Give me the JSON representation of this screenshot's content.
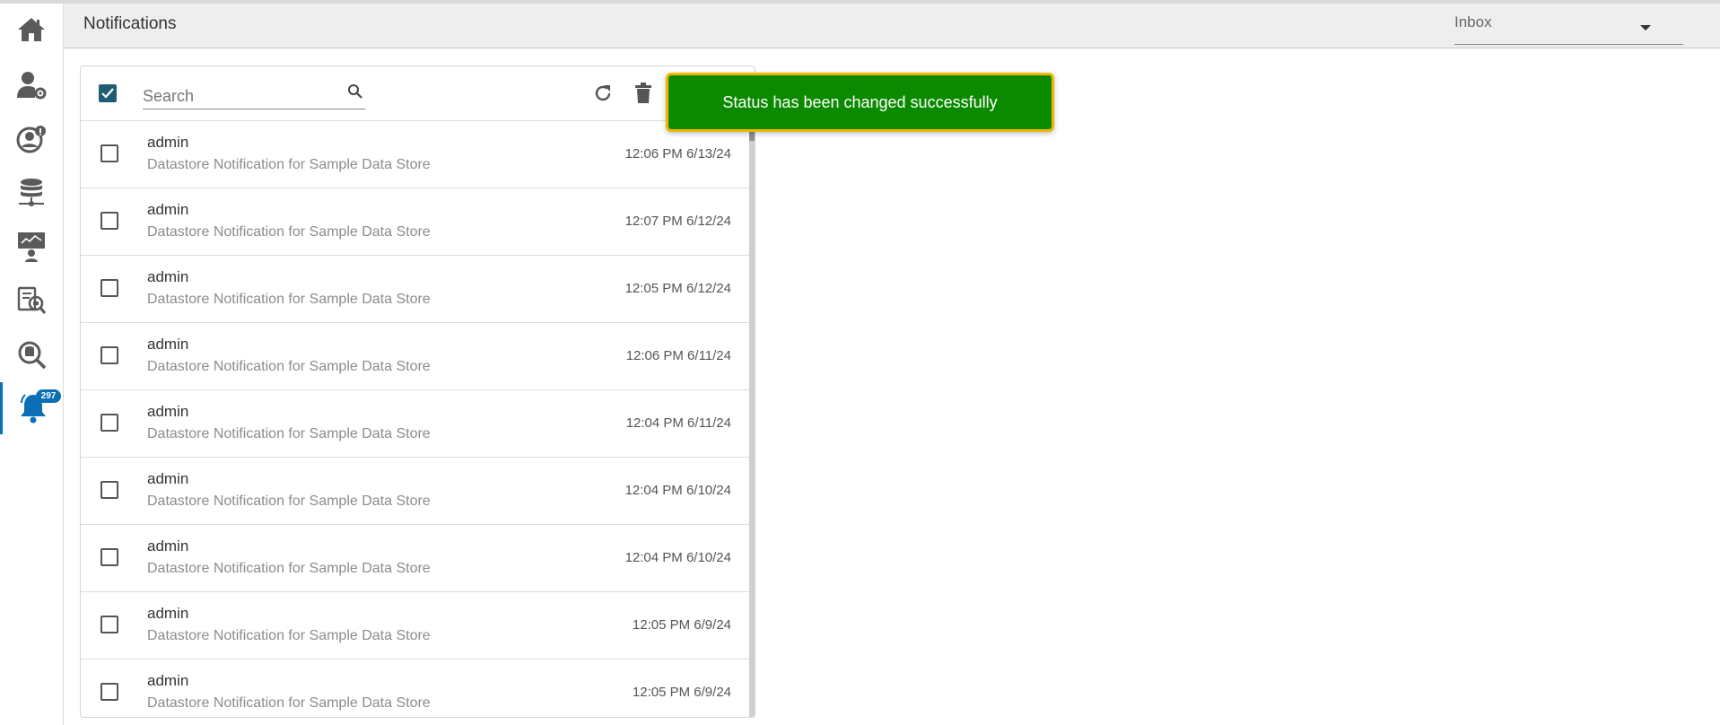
{
  "header": {
    "title": "Notifications"
  },
  "folder": {
    "selected": "Inbox"
  },
  "sidebar": {
    "items": [
      {
        "icon": "home-icon"
      },
      {
        "icon": "user-settings-icon"
      },
      {
        "icon": "user-security-icon"
      },
      {
        "icon": "database-network-icon"
      },
      {
        "icon": "dashboard-presenter-icon"
      },
      {
        "icon": "report-search-icon"
      },
      {
        "icon": "data-search-icon"
      },
      {
        "icon": "bell-icon",
        "badge": "297",
        "active": true
      }
    ]
  },
  "search": {
    "placeholder": "Search",
    "value": ""
  },
  "toast": {
    "message": "Status has been changed successfully"
  },
  "notifications": [
    {
      "sender": "admin",
      "subject": "Datastore Notification for Sample Data Store",
      "time": "12:06 PM 6/13/24"
    },
    {
      "sender": "admin",
      "subject": "Datastore Notification for Sample Data Store",
      "time": "12:07 PM 6/12/24"
    },
    {
      "sender": "admin",
      "subject": "Datastore Notification for Sample Data Store",
      "time": "12:05 PM 6/12/24"
    },
    {
      "sender": "admin",
      "subject": "Datastore Notification for Sample Data Store",
      "time": "12:06 PM 6/11/24"
    },
    {
      "sender": "admin",
      "subject": "Datastore Notification for Sample Data Store",
      "time": "12:04 PM 6/11/24"
    },
    {
      "sender": "admin",
      "subject": "Datastore Notification for Sample Data Store",
      "time": "12:04 PM 6/10/24"
    },
    {
      "sender": "admin",
      "subject": "Datastore Notification for Sample Data Store",
      "time": "12:04 PM 6/10/24"
    },
    {
      "sender": "admin",
      "subject": "Datastore Notification for Sample Data Store",
      "time": "12:05 PM 6/9/24"
    },
    {
      "sender": "admin",
      "subject": "Datastore Notification for Sample Data Store",
      "time": "12:05 PM 6/9/24"
    }
  ],
  "colors": {
    "accent": "#0b6fb8",
    "toast_bg": "#0b8a00",
    "toast_border": "#f4b400",
    "checkbox_checked": "#1e5b74"
  }
}
